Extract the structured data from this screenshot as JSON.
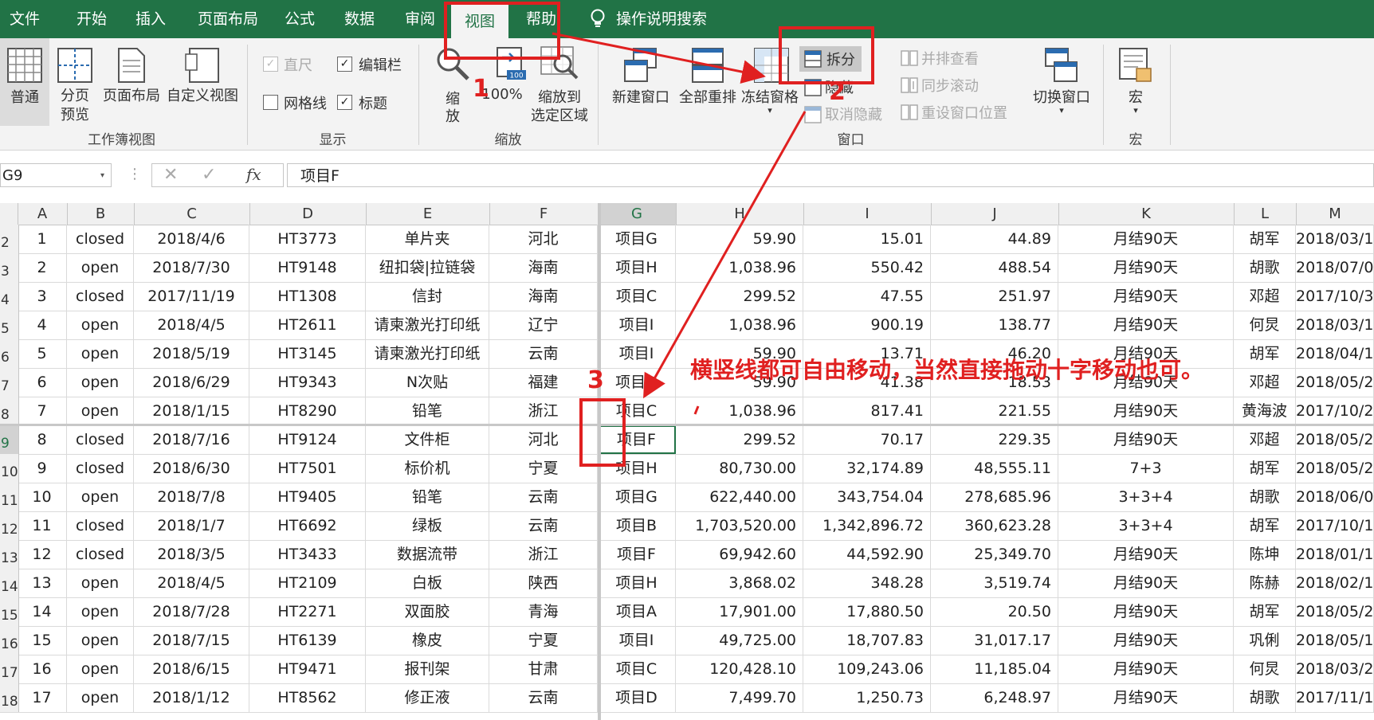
{
  "menu": {
    "tabs": [
      "文件",
      "开始",
      "插入",
      "页面布局",
      "公式",
      "数据",
      "审阅",
      "视图",
      "帮助"
    ],
    "active": "视图",
    "search": "操作说明搜索"
  },
  "ribbon": {
    "workbook_views": {
      "group": "工作簿视图",
      "normal": "普通",
      "page_break_line1": "分页",
      "page_break_line2": "预览",
      "page_layout": "页面布局",
      "custom_views": "自定义视图"
    },
    "show": {
      "group": "显示",
      "ruler": "直尺",
      "formula_bar": "编辑栏",
      "gridlines": "网格线",
      "headings": "标题",
      "ruler_checked": true,
      "formula_bar_checked": true,
      "gridlines_checked": false,
      "headings_checked": true
    },
    "zoom": {
      "group": "缩放",
      "zoom_line1": "缩",
      "zoom_line2": "放",
      "hundred": "100%",
      "hundred_icon": "100",
      "to_selection_line1": "缩放到",
      "to_selection_line2": "选定区域"
    },
    "window": {
      "group": "窗口",
      "new_window": "新建窗口",
      "arrange_all": "全部重排",
      "freeze_panes": "冻结窗格",
      "split": "拆分",
      "hide": "隐藏",
      "unhide": "取消隐藏",
      "view_side_by_side": "并排查看",
      "sync_scroll": "同步滚动",
      "reset_position": "重设窗口位置",
      "switch_windows": "切换窗口"
    },
    "macros": {
      "group": "宏",
      "macros": "宏"
    }
  },
  "formula_bar": {
    "name_box": "G9",
    "fx": "fx",
    "value": "项目F"
  },
  "columns": [
    "A",
    "B",
    "C",
    "D",
    "E",
    "F",
    "G",
    "H",
    "I",
    "J",
    "K",
    "L",
    "M"
  ],
  "selected_cell": "G9",
  "rows": [
    {
      "n": "2",
      "cells": [
        "1",
        "closed",
        "2018/4/6",
        "HT3773",
        "单片夹",
        "河北",
        "项目G",
        "59.90",
        "15.01",
        "44.89",
        "月结90天",
        "胡军",
        "2018/03/1"
      ]
    },
    {
      "n": "3",
      "cells": [
        "2",
        "open",
        "2018/7/30",
        "HT9148",
        "纽扣袋|拉链袋",
        "海南",
        "项目H",
        "1,038.96",
        "550.42",
        "488.54",
        "月结90天",
        "胡歌",
        "2018/07/0"
      ]
    },
    {
      "n": "4",
      "cells": [
        "3",
        "closed",
        "2017/11/19",
        "HT1308",
        "信封",
        "海南",
        "项目C",
        "299.52",
        "47.55",
        "251.97",
        "月结90天",
        "邓超",
        "2017/10/3"
      ]
    },
    {
      "n": "5",
      "cells": [
        "4",
        "open",
        "2018/4/5",
        "HT2611",
        "请柬激光打印纸",
        "辽宁",
        "项目I",
        "1,038.96",
        "900.19",
        "138.77",
        "月结90天",
        "何炅",
        "2018/03/1"
      ]
    },
    {
      "n": "6",
      "cells": [
        "5",
        "open",
        "2018/5/19",
        "HT3145",
        "请柬激光打印纸",
        "云南",
        "项目I",
        "59.90",
        "13.71",
        "46.20",
        "月结90天",
        "胡军",
        "2018/04/1"
      ]
    },
    {
      "n": "7",
      "cells": [
        "6",
        "open",
        "2018/6/29",
        "HT9343",
        "N次贴",
        "福建",
        "项目D",
        "59.90",
        "41.38",
        "18.53",
        "月结90天",
        "邓超",
        "2018/05/2"
      ]
    },
    {
      "n": "8",
      "cells": [
        "7",
        "open",
        "2018/1/15",
        "HT8290",
        "铅笔",
        "浙江",
        "项目C",
        "1,038.96",
        "817.41",
        "221.55",
        "月结90天",
        "黄海波",
        "2017/10/2"
      ]
    },
    {
      "n": "9",
      "cells": [
        "8",
        "closed",
        "2018/7/16",
        "HT9124",
        "文件柜",
        "河北",
        "项目F",
        "299.52",
        "70.17",
        "229.35",
        "月结90天",
        "邓超",
        "2018/05/2"
      ]
    },
    {
      "n": "10",
      "cells": [
        "9",
        "closed",
        "2018/6/30",
        "HT7501",
        "标价机",
        "宁夏",
        "项目H",
        "80,730.00",
        "32,174.89",
        "48,555.11",
        "7+3",
        "胡军",
        "2018/05/2"
      ]
    },
    {
      "n": "11",
      "cells": [
        "10",
        "open",
        "2018/7/8",
        "HT9405",
        "铅笔",
        "云南",
        "项目G",
        "622,440.00",
        "343,754.04",
        "278,685.96",
        "3+3+4",
        "胡歌",
        "2018/06/0"
      ]
    },
    {
      "n": "12",
      "cells": [
        "11",
        "closed",
        "2018/1/7",
        "HT6692",
        "绿板",
        "云南",
        "项目B",
        "1,703,520.00",
        "1,342,896.72",
        "360,623.28",
        "3+3+4",
        "胡军",
        "2017/10/1"
      ]
    },
    {
      "n": "13",
      "cells": [
        "12",
        "closed",
        "2018/3/5",
        "HT3433",
        "数据流带",
        "浙江",
        "项目F",
        "69,942.60",
        "44,592.90",
        "25,349.70",
        "月结90天",
        "陈坤",
        "2018/01/1"
      ]
    },
    {
      "n": "14",
      "cells": [
        "13",
        "open",
        "2018/4/5",
        "HT2109",
        "白板",
        "陕西",
        "项目H",
        "3,868.02",
        "348.28",
        "3,519.74",
        "月结90天",
        "陈赫",
        "2018/02/1"
      ]
    },
    {
      "n": "15",
      "cells": [
        "14",
        "open",
        "2018/7/28",
        "HT2271",
        "双面胶",
        "青海",
        "项目A",
        "17,901.00",
        "17,880.50",
        "20.50",
        "月结90天",
        "胡军",
        "2018/05/2"
      ]
    },
    {
      "n": "16",
      "cells": [
        "15",
        "open",
        "2018/7/15",
        "HT6139",
        "橡皮",
        "宁夏",
        "项目I",
        "49,725.00",
        "18,707.83",
        "31,017.17",
        "月结90天",
        "巩俐",
        "2018/05/1"
      ]
    },
    {
      "n": "17",
      "cells": [
        "16",
        "open",
        "2018/6/15",
        "HT9471",
        "报刊架",
        "甘肃",
        "项目C",
        "120,428.10",
        "109,243.06",
        "11,185.04",
        "月结90天",
        "何炅",
        "2018/03/2"
      ]
    },
    {
      "n": "18",
      "cells": [
        "17",
        "open",
        "2018/1/12",
        "HT8562",
        "修正液",
        "云南",
        "项目D",
        "7,499.70",
        "1,250.73",
        "6,248.97",
        "月结90天",
        "胡歌",
        "2017/11/1"
      ]
    }
  ],
  "annotations": {
    "num1": "1",
    "num2": "2",
    "num3": "3",
    "text": "横竖线都可自由移动，当然直接拖动十字移动也可。",
    "color": "#e02020"
  }
}
